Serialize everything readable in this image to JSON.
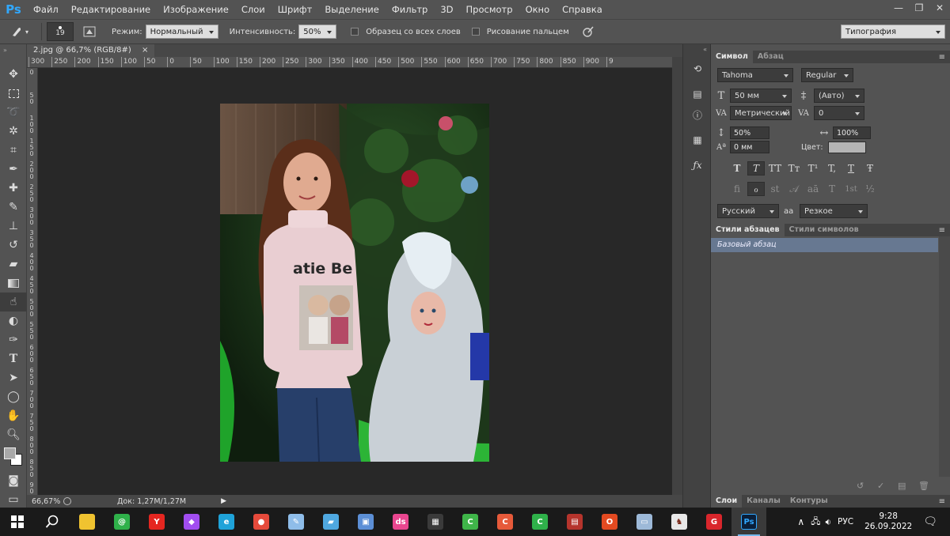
{
  "app": {
    "logo": "Ps",
    "window_controls": [
      "—",
      "❐",
      "✕"
    ]
  },
  "menu": [
    "Файл",
    "Редактирование",
    "Изображение",
    "Слои",
    "Шрифт",
    "Выделение",
    "Фильтр",
    "3D",
    "Просмотр",
    "Окно",
    "Справка"
  ],
  "options": {
    "brush_size": "19",
    "mode_label": "Режим:",
    "mode_value": "Нормальный",
    "strength_label": "Интенсивность:",
    "strength_value": "50%",
    "sample_all_label": "Образец со всех слоев",
    "finger_paint_label": "Рисование пальцем",
    "workspace": "Типография"
  },
  "document": {
    "tab_title": "2.jpg @ 66,7% (RGB/8#)",
    "close": "×",
    "zoom": "66,67%",
    "doc_info": "Док: 1,27M/1,27M"
  },
  "ruler_top": [
    "300",
    "250",
    "200",
    "150",
    "100",
    "50",
    "0",
    "50",
    "100",
    "150",
    "200",
    "250",
    "300",
    "350",
    "400",
    "450",
    "500",
    "550",
    "600",
    "650",
    "700",
    "750",
    "800",
    "850",
    "900",
    "9"
  ],
  "ruler_left": [
    "0",
    "5 0",
    "1 0 0",
    "1 5 0",
    "2 0 0",
    "2 5 0",
    "3 0 0",
    "3 5 0",
    "4 0 0",
    "4 5 0",
    "5 0 0",
    "5 5 0",
    "6 0 0",
    "6 5 0",
    "7 0 0",
    "7 5 0",
    "8 0 0",
    "8 5 0",
    "9 0 0",
    "9 5 0"
  ],
  "photo_text": "atie Be",
  "character_panel": {
    "tabs": [
      "Символ",
      "Абзац"
    ],
    "font_family": "Tahoma",
    "font_style": "Regular",
    "size": "50 мм",
    "leading": "(Авто)",
    "kerning": "Метрический",
    "tracking": "0",
    "vscale": "50%",
    "hscale": "100%",
    "baseline": "0 мм",
    "color_label": "Цвет:",
    "color": "#b5b5b5",
    "style_buttons": [
      "T",
      "T",
      "TT",
      "Tт",
      "T¹",
      "T,",
      "T",
      "Ŧ"
    ],
    "opentype_buttons": [
      "ﬁ",
      "ℴ",
      "st",
      "𝒜",
      "aā",
      "T",
      "1st",
      "½"
    ],
    "language": "Русский",
    "antialias_icon": "aa",
    "antialias": "Резкое"
  },
  "styles_panel": {
    "tabs": [
      "Стили абзацев",
      "Стили символов"
    ],
    "items": [
      "Базовый абзац"
    ]
  },
  "layers_panel": {
    "tabs": [
      "Слои",
      "Каналы",
      "Контуры"
    ]
  },
  "taskbar": {
    "apps": [
      {
        "name": "file-explorer",
        "color": "#f0c330",
        "glyph": ""
      },
      {
        "name": "mail",
        "color": "#2fb14a",
        "glyph": "@"
      },
      {
        "name": "yandex",
        "color": "#e52620",
        "glyph": "Y"
      },
      {
        "name": "gem",
        "color": "#a14df0",
        "glyph": "◆"
      },
      {
        "name": "edge",
        "color": "#1fa3d9",
        "glyph": "e"
      },
      {
        "name": "chrome",
        "color": "#e64a3b",
        "glyph": "●"
      },
      {
        "name": "paint",
        "color": "#8fbde9",
        "glyph": "✎"
      },
      {
        "name": "notes",
        "color": "#4fa8e0",
        "glyph": "▰"
      },
      {
        "name": "viewer",
        "color": "#5c8fd6",
        "glyph": "▣"
      },
      {
        "name": "ds",
        "color": "#e9468f",
        "glyph": "ds"
      },
      {
        "name": "film",
        "color": "#3a3a3a",
        "glyph": "▦"
      },
      {
        "name": "camtasia-1",
        "color": "#3fb549",
        "glyph": "C"
      },
      {
        "name": "camtasia-2",
        "color": "#e65a3a",
        "glyph": "C"
      },
      {
        "name": "camtasia-3",
        "color": "#2fb14a",
        "glyph": "C"
      },
      {
        "name": "archive",
        "color": "#b5342c",
        "glyph": "▤"
      },
      {
        "name": "office",
        "color": "#e34a21",
        "glyph": "O"
      },
      {
        "name": "screenshot",
        "color": "#9db9d8",
        "glyph": "▭"
      },
      {
        "name": "horse",
        "color": "#e8e8e8",
        "glyph": "♞"
      },
      {
        "name": "g-app",
        "color": "#d9262c",
        "glyph": "G"
      },
      {
        "name": "photoshop",
        "color": "#0b1f39",
        "glyph": "Ps"
      }
    ],
    "lang": "РУС",
    "time": "9:28",
    "date": "26.09.2022"
  }
}
